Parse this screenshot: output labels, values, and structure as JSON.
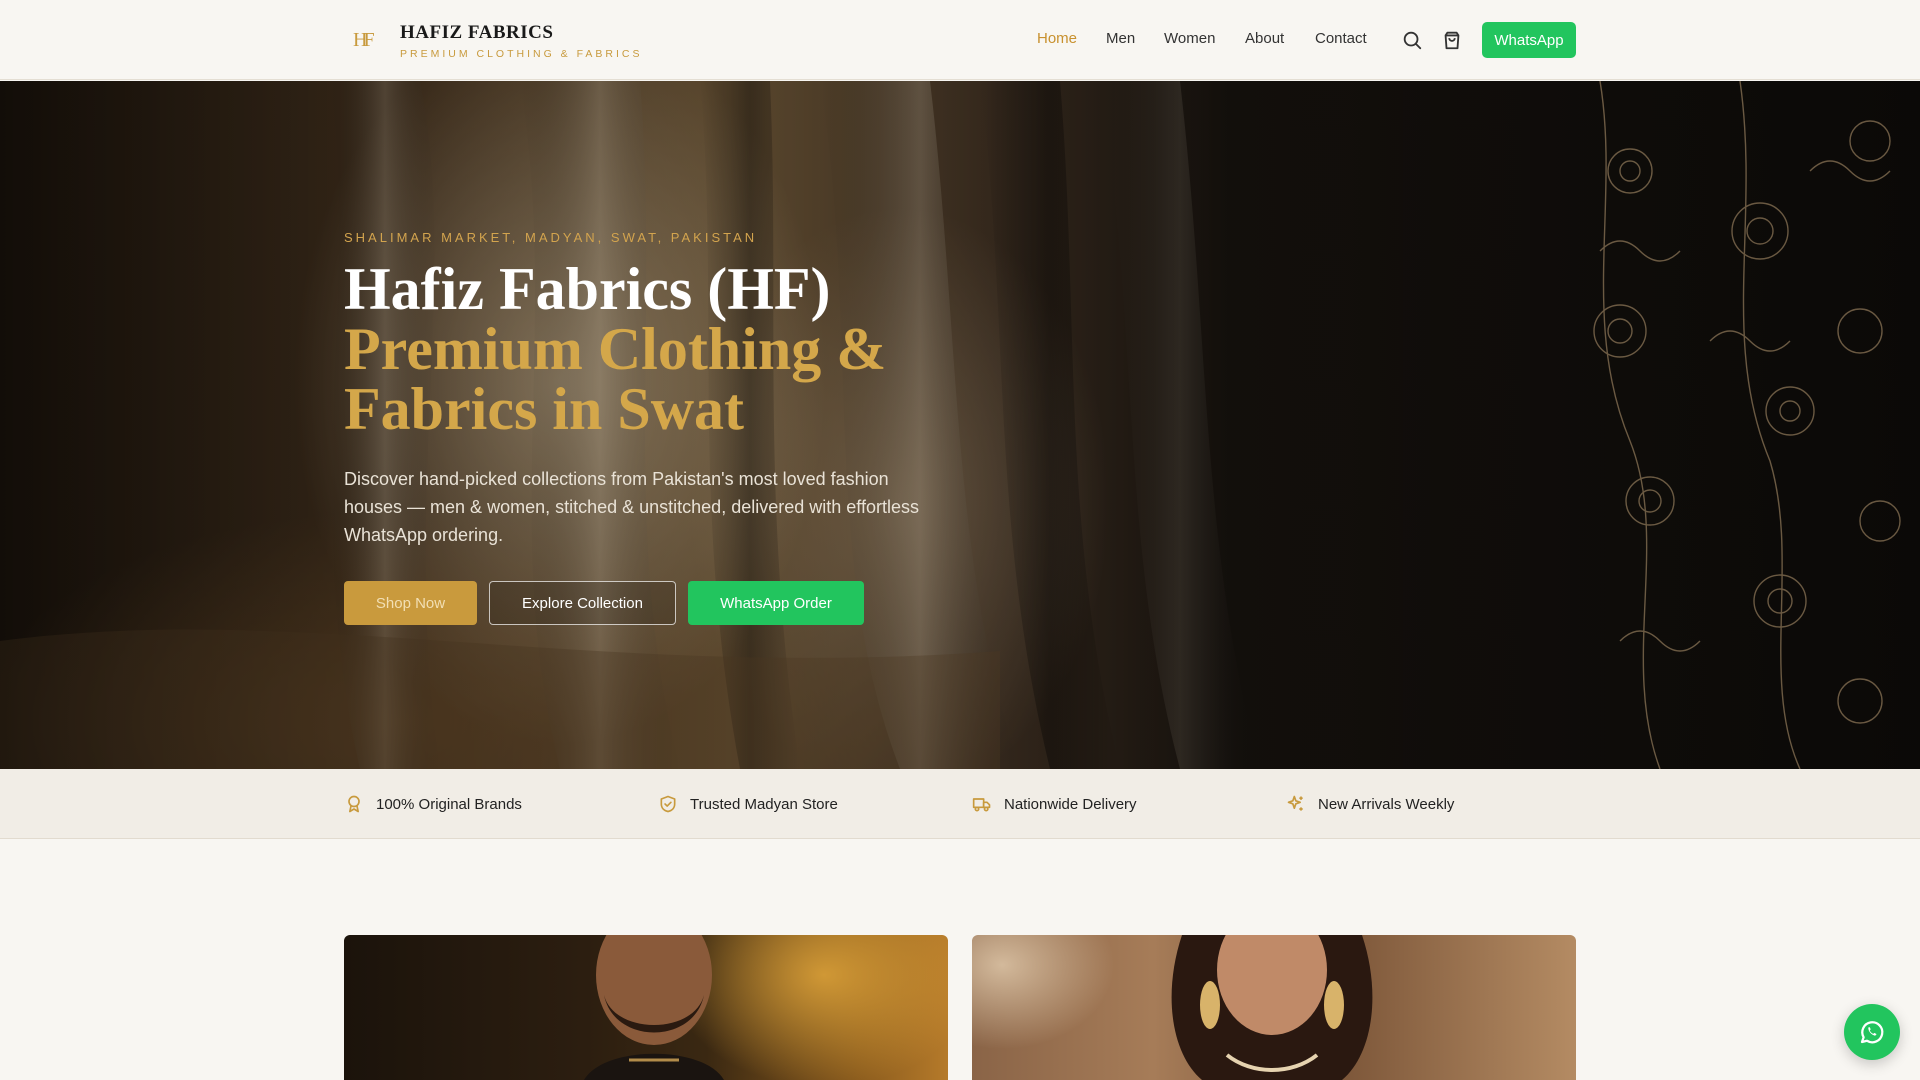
{
  "brand": {
    "name": "HAFIZ FABRICS",
    "tagline": "PREMIUM CLOTHING & FABRICS",
    "logo_letters": "HF"
  },
  "nav": {
    "items": [
      "Home",
      "Men",
      "Women",
      "About",
      "Contact"
    ],
    "active": "Home",
    "whatsapp_label": "WhatsApp"
  },
  "icons": {
    "search": "search-icon",
    "cart": "shopping-bag-icon",
    "float": "whatsapp-icon"
  },
  "hero": {
    "kicker": "SHALIMAR MARKET, MADYAN, SWAT, PAKISTAN",
    "title_line1": "Hafiz Fabrics (HF)",
    "title_line2": "Premium Clothing &",
    "title_line3": "Fabrics in Swat",
    "description": "Discover hand-picked collections from Pakistan's most loved fashion houses — men & women, stitched & unstitched, delivered with effortless WhatsApp ordering.",
    "buttons": {
      "shop": "Shop Now",
      "explore": "Explore Collection",
      "whatsapp": "WhatsApp Order"
    }
  },
  "features": [
    "100% Original Brands",
    "Trusted Madyan Store",
    "Nationwide Delivery",
    "New Arrivals Weekly"
  ],
  "colors": {
    "gold": "#d4a74a",
    "green": "#22c55e",
    "background": "#f8f6f2"
  }
}
